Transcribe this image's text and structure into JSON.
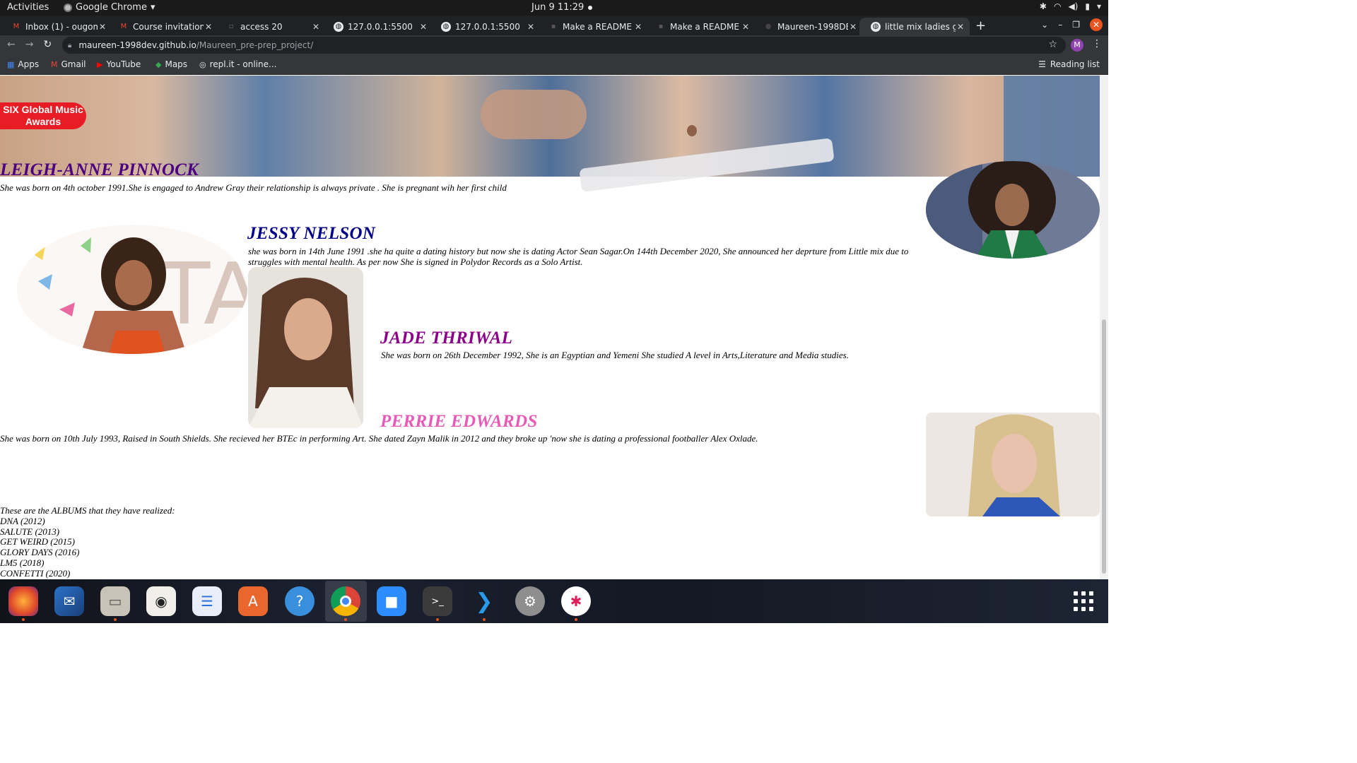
{
  "system_bar": {
    "activities": "Activities",
    "app_name": "Google Chrome",
    "clock": "Jun 9  11:29"
  },
  "browser": {
    "tabs": [
      {
        "title": "Inbox (1) - ougom",
        "icon": "gmail-icon"
      },
      {
        "title": "Course invitation",
        "icon": "gmail-icon"
      },
      {
        "title": "access 20",
        "icon": "page-icon"
      },
      {
        "title": "127.0.0.1:5500",
        "icon": "globe-icon"
      },
      {
        "title": "127.0.0.1:5500",
        "icon": "globe-icon"
      },
      {
        "title": "Make a README",
        "icon": "page-icon"
      },
      {
        "title": "Make a README",
        "icon": "page-icon"
      },
      {
        "title": "Maureen-1998DE",
        "icon": "github-icon"
      },
      {
        "title": "little mix ladies g",
        "icon": "globe-icon",
        "active": true
      }
    ],
    "url_host": "maureen-1998dev.github.io",
    "url_path": "/Maureen_pre-prep_project/",
    "profile_initial": "M",
    "bookmarks": [
      "Apps",
      "Gmail",
      "YouTube",
      "Maps",
      "repl.it - online..."
    ],
    "reading_list": "Reading list"
  },
  "page": {
    "award_button": "SIX Global Music Awards",
    "members": [
      {
        "name": "LEIGH-ANNE PINNOCK",
        "color": "#4b0082",
        "bio": "She was born on 4th october 1991.She is engaged to Andrew Gray their relationship is always private . She is pregnant wih her first child"
      },
      {
        "name": "JESSY NELSON",
        "color": "#00008b",
        "bio": "she was born in 14th June 1991 .she ha quite a dating history but now she is dating Actor Sean Sagar.On 144th December 2020, She announced her deprture from Little mix due to struggles with mental health. As per now She is signed in Polydor Records as a Solo Artist."
      },
      {
        "name": "JADE THRIWAL",
        "color": "#8b008b",
        "bio": "She was born on 26th December 1992, She is an Egyptian and Yemeni She studied A level in Arts,Literature and Media studies."
      },
      {
        "name": "PERRIE EDWARDS",
        "color": "#e75ab6",
        "bio": "She was born on 10th July 1993, Raised in South Shields. She recieved her BTEc in performing Art. She dated Zayn Malik in 2012 and they broke up 'now she is dating a professional footballer Alex Oxlade."
      }
    ],
    "albums_intro": "These are the ALBUMS that they have realized:",
    "albums": [
      "DNA (2012)",
      "SALUTE (2013)",
      "GET WEIRD (2015)",
      "GLORY DAYS (2016)",
      "LM5 (2018)",
      "CONFETTI (2020)"
    ]
  },
  "dock": [
    "Firefox",
    "Thunderbird",
    "Files",
    "Rhythmbox",
    "LibreOffice Writer",
    "Ubuntu Software",
    "Help",
    "Google Chrome",
    "Zoom",
    "Terminal",
    "Visual Studio Code",
    "Settings",
    "Slack"
  ]
}
